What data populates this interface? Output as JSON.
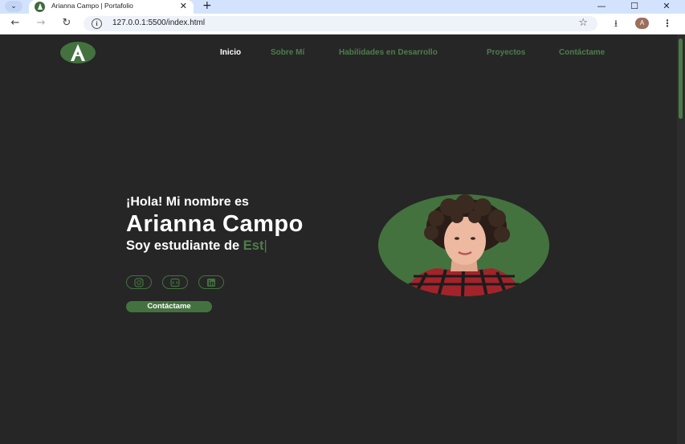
{
  "browser": {
    "tab_title": "Arianna Campo | Portafolio",
    "url": "127.0.0.1:5500/index.html",
    "profile_initial": "A"
  },
  "nav": {
    "items": [
      {
        "label": "Inicio",
        "active": true
      },
      {
        "label": "Sobre Mí",
        "active": false
      },
      {
        "label": "Habilidades en Desarrollo",
        "active": false
      },
      {
        "label": "Proyectos",
        "active": false
      },
      {
        "label": "Contáctame",
        "active": false
      }
    ]
  },
  "hero": {
    "greeting": "¡Hola! Mi nombre es",
    "name": "Arianna Campo",
    "role_prefix": "Soy estudiante de",
    "role_typed": "Est",
    "cursor": "|",
    "cta_label": "Contáctame"
  },
  "social": [
    {
      "icon": "instagram-icon"
    },
    {
      "icon": "code-icon"
    },
    {
      "icon": "linkedin-icon"
    }
  ],
  "colors": {
    "accent": "#43723f",
    "accent_text": "#4e7d4b",
    "background": "#262626"
  }
}
